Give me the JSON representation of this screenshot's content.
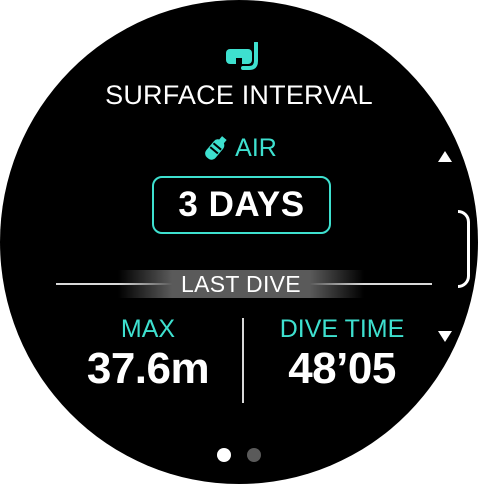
{
  "header": {
    "icon": "diving-mask-snorkel-icon",
    "title": "SURFACE INTERVAL"
  },
  "gas": {
    "icon": "air-tank-icon",
    "label": "AIR"
  },
  "surface_interval": {
    "value": "3 DAYS"
  },
  "last_dive": {
    "label": "LAST DIVE",
    "max_label": "MAX",
    "max_value": "37.6m",
    "time_label": "DIVE TIME",
    "time_value": "48’05"
  },
  "pager": {
    "pages": 2,
    "current": 1
  },
  "colors": {
    "accent": "#3ee0cf",
    "background": "#000000",
    "text": "#ffffff"
  }
}
